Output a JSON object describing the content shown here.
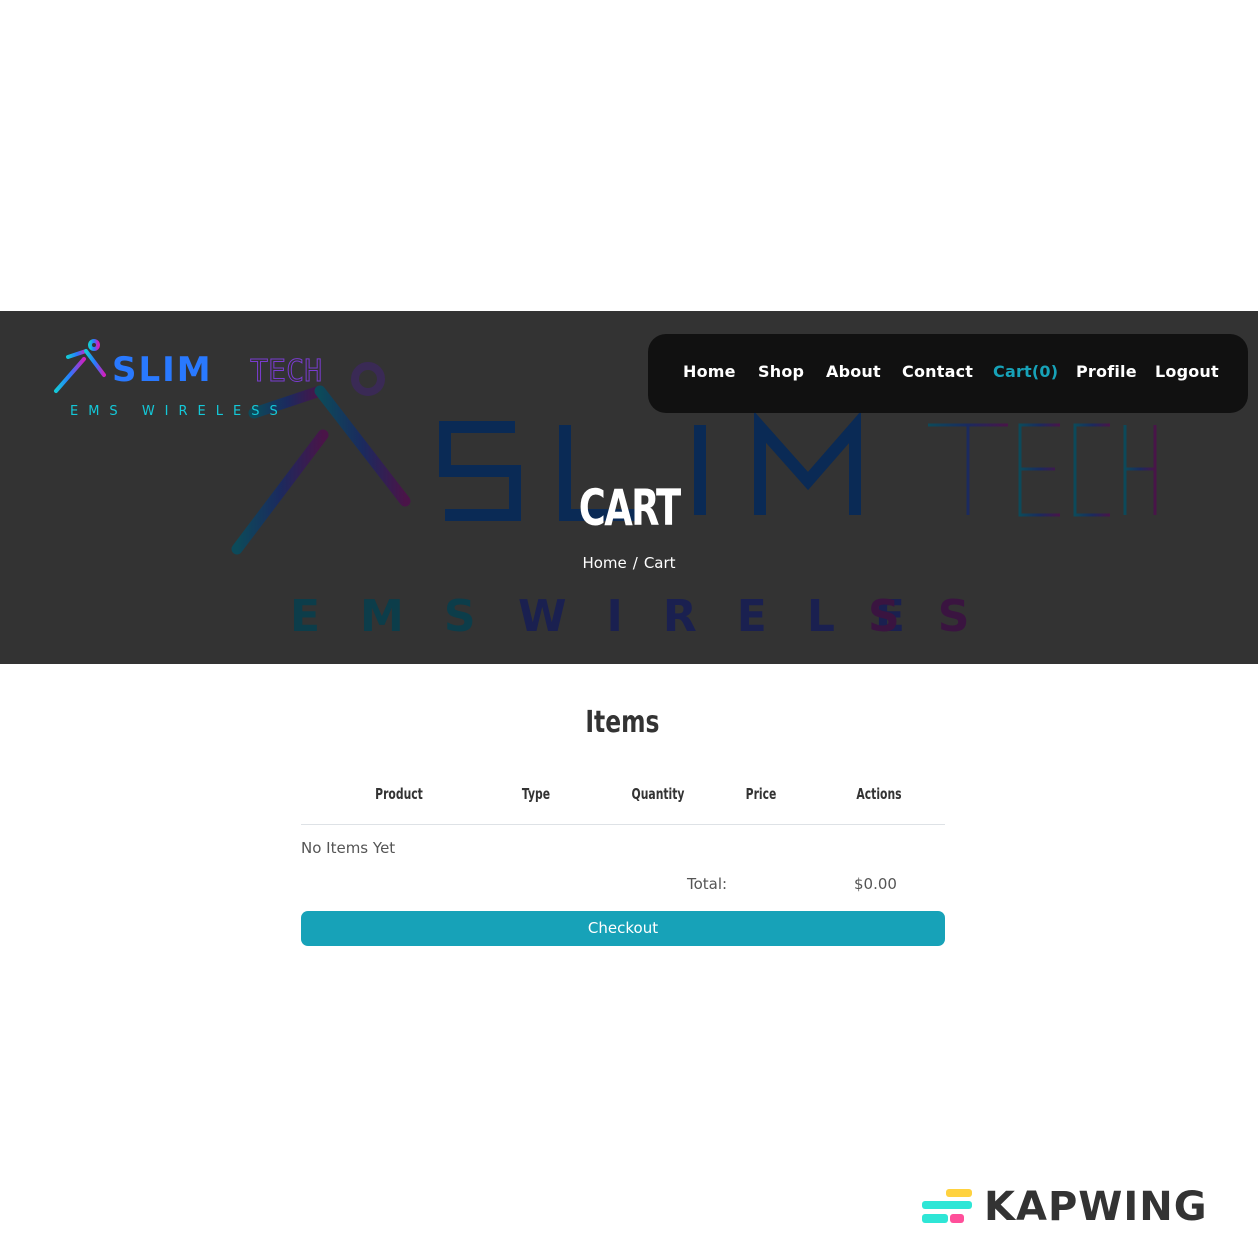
{
  "brand": {
    "name_main": "SLIM",
    "name_accent": "TECH",
    "tagline": "EMS WIRELESS"
  },
  "nav": {
    "items": [
      {
        "label": "Home",
        "active": false
      },
      {
        "label": "Shop",
        "active": false
      },
      {
        "label": "About",
        "active": false
      },
      {
        "label": "Contact",
        "active": false
      },
      {
        "label": "Cart(0)",
        "active": true
      },
      {
        "label": "Profile",
        "active": false
      },
      {
        "label": "Logout",
        "active": false
      }
    ]
  },
  "hero": {
    "title": "CART",
    "breadcrumb": {
      "home": "Home",
      "separator": "/",
      "current": "Cart"
    }
  },
  "cart": {
    "heading": "Items",
    "columns": [
      "Product",
      "Type",
      "Quantity",
      "Price",
      "Actions"
    ],
    "empty_message": "No Items Yet",
    "total_label": "Total:",
    "total_value": "$0.00",
    "checkout_label": "Checkout"
  },
  "watermark": {
    "text": "KAPWING"
  },
  "colors": {
    "accent": "#17a2b8",
    "hero_bg": "#333333",
    "nav_bg": "#111111",
    "brand_blue": "#2979ff",
    "brand_purple": "#a020f0",
    "brand_cyan": "#14c8d8"
  }
}
